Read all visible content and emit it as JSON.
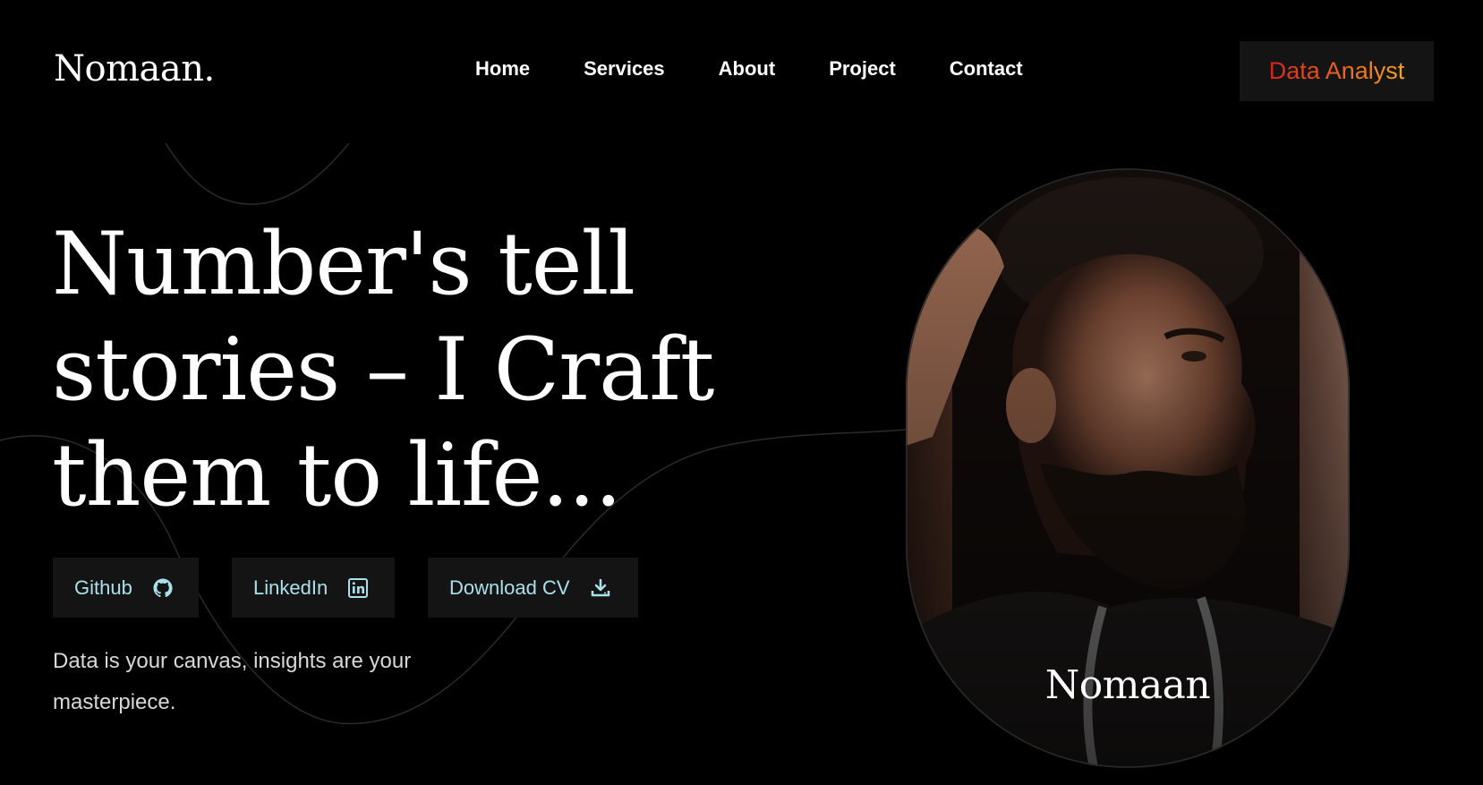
{
  "header": {
    "logo": "Nomaan.",
    "nav": [
      "Home",
      "Services",
      "About",
      "Project",
      "Contact"
    ],
    "role_badge": "Data Analyst"
  },
  "hero": {
    "headline_lines": [
      "Number's tell",
      "stories – I Craft",
      "them to life..."
    ],
    "buttons": {
      "github": {
        "label": "Github",
        "icon": "github-icon"
      },
      "linkedin": {
        "label": "LinkedIn",
        "icon": "linkedin-icon"
      },
      "cv": {
        "label": "Download CV",
        "icon": "download-icon"
      }
    },
    "tagline": "Data is your canvas, insights are your masterpiece."
  },
  "portrait": {
    "name": "Nomaan"
  },
  "colors": {
    "background": "#000000",
    "button_bg": "#141414",
    "button_text": "#a9e0ea",
    "badge_gradient_start": "#d8221c",
    "badge_gradient_end": "#f5a623"
  }
}
